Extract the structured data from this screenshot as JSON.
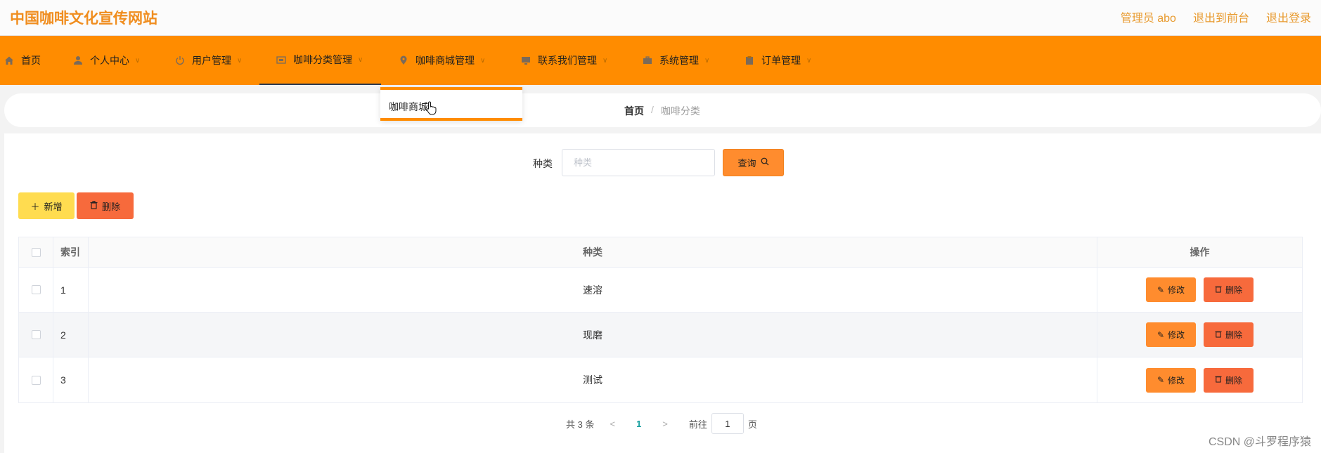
{
  "header": {
    "site_title": "中国咖啡文化宣传网站",
    "links": [
      "管理员 abo",
      "退出到前台",
      "退出登录"
    ]
  },
  "nav": {
    "items": [
      {
        "label": "首页",
        "icon": "home-icon"
      },
      {
        "label": "个人中心",
        "icon": "user-icon"
      },
      {
        "label": "用户管理",
        "icon": "power-icon"
      },
      {
        "label": "咖啡分类管理",
        "icon": "folder-icon"
      },
      {
        "label": "咖啡商城管理",
        "icon": "location-icon"
      },
      {
        "label": "联系我们管理",
        "icon": "monitor-icon"
      },
      {
        "label": "系统管理",
        "icon": "suitcase-icon"
      },
      {
        "label": "订单管理",
        "icon": "clipboard-icon"
      }
    ],
    "dropdown_item": "咖啡商城"
  },
  "breadcrumb": {
    "home": "首页",
    "separator": "/",
    "current": "咖啡分类"
  },
  "search": {
    "label": "种类",
    "placeholder": "种类",
    "query_button": "查询"
  },
  "actions": {
    "add": "新增",
    "delete": "删除"
  },
  "table": {
    "headers": [
      "索引",
      "种类",
      "操作"
    ],
    "rows": [
      {
        "index": "1",
        "type": "速溶"
      },
      {
        "index": "2",
        "type": "现磨"
      },
      {
        "index": "3",
        "type": "测试"
      }
    ],
    "edit_label": "修改",
    "delete_label": "删除"
  },
  "pagination": {
    "total": "共 3 条",
    "current_page": "1",
    "goto_prefix": "前往",
    "goto_value": "1",
    "goto_suffix": "页"
  },
  "watermark": "CSDN @斗罗程序猿",
  "colors": {
    "nav_bg": "#ff8c00",
    "title": "#f08d1e",
    "query_button": "#ff8c2e",
    "add_button": "#ffdc50",
    "delete_button": "#f76a3c",
    "page_active": "#18a0a0"
  }
}
